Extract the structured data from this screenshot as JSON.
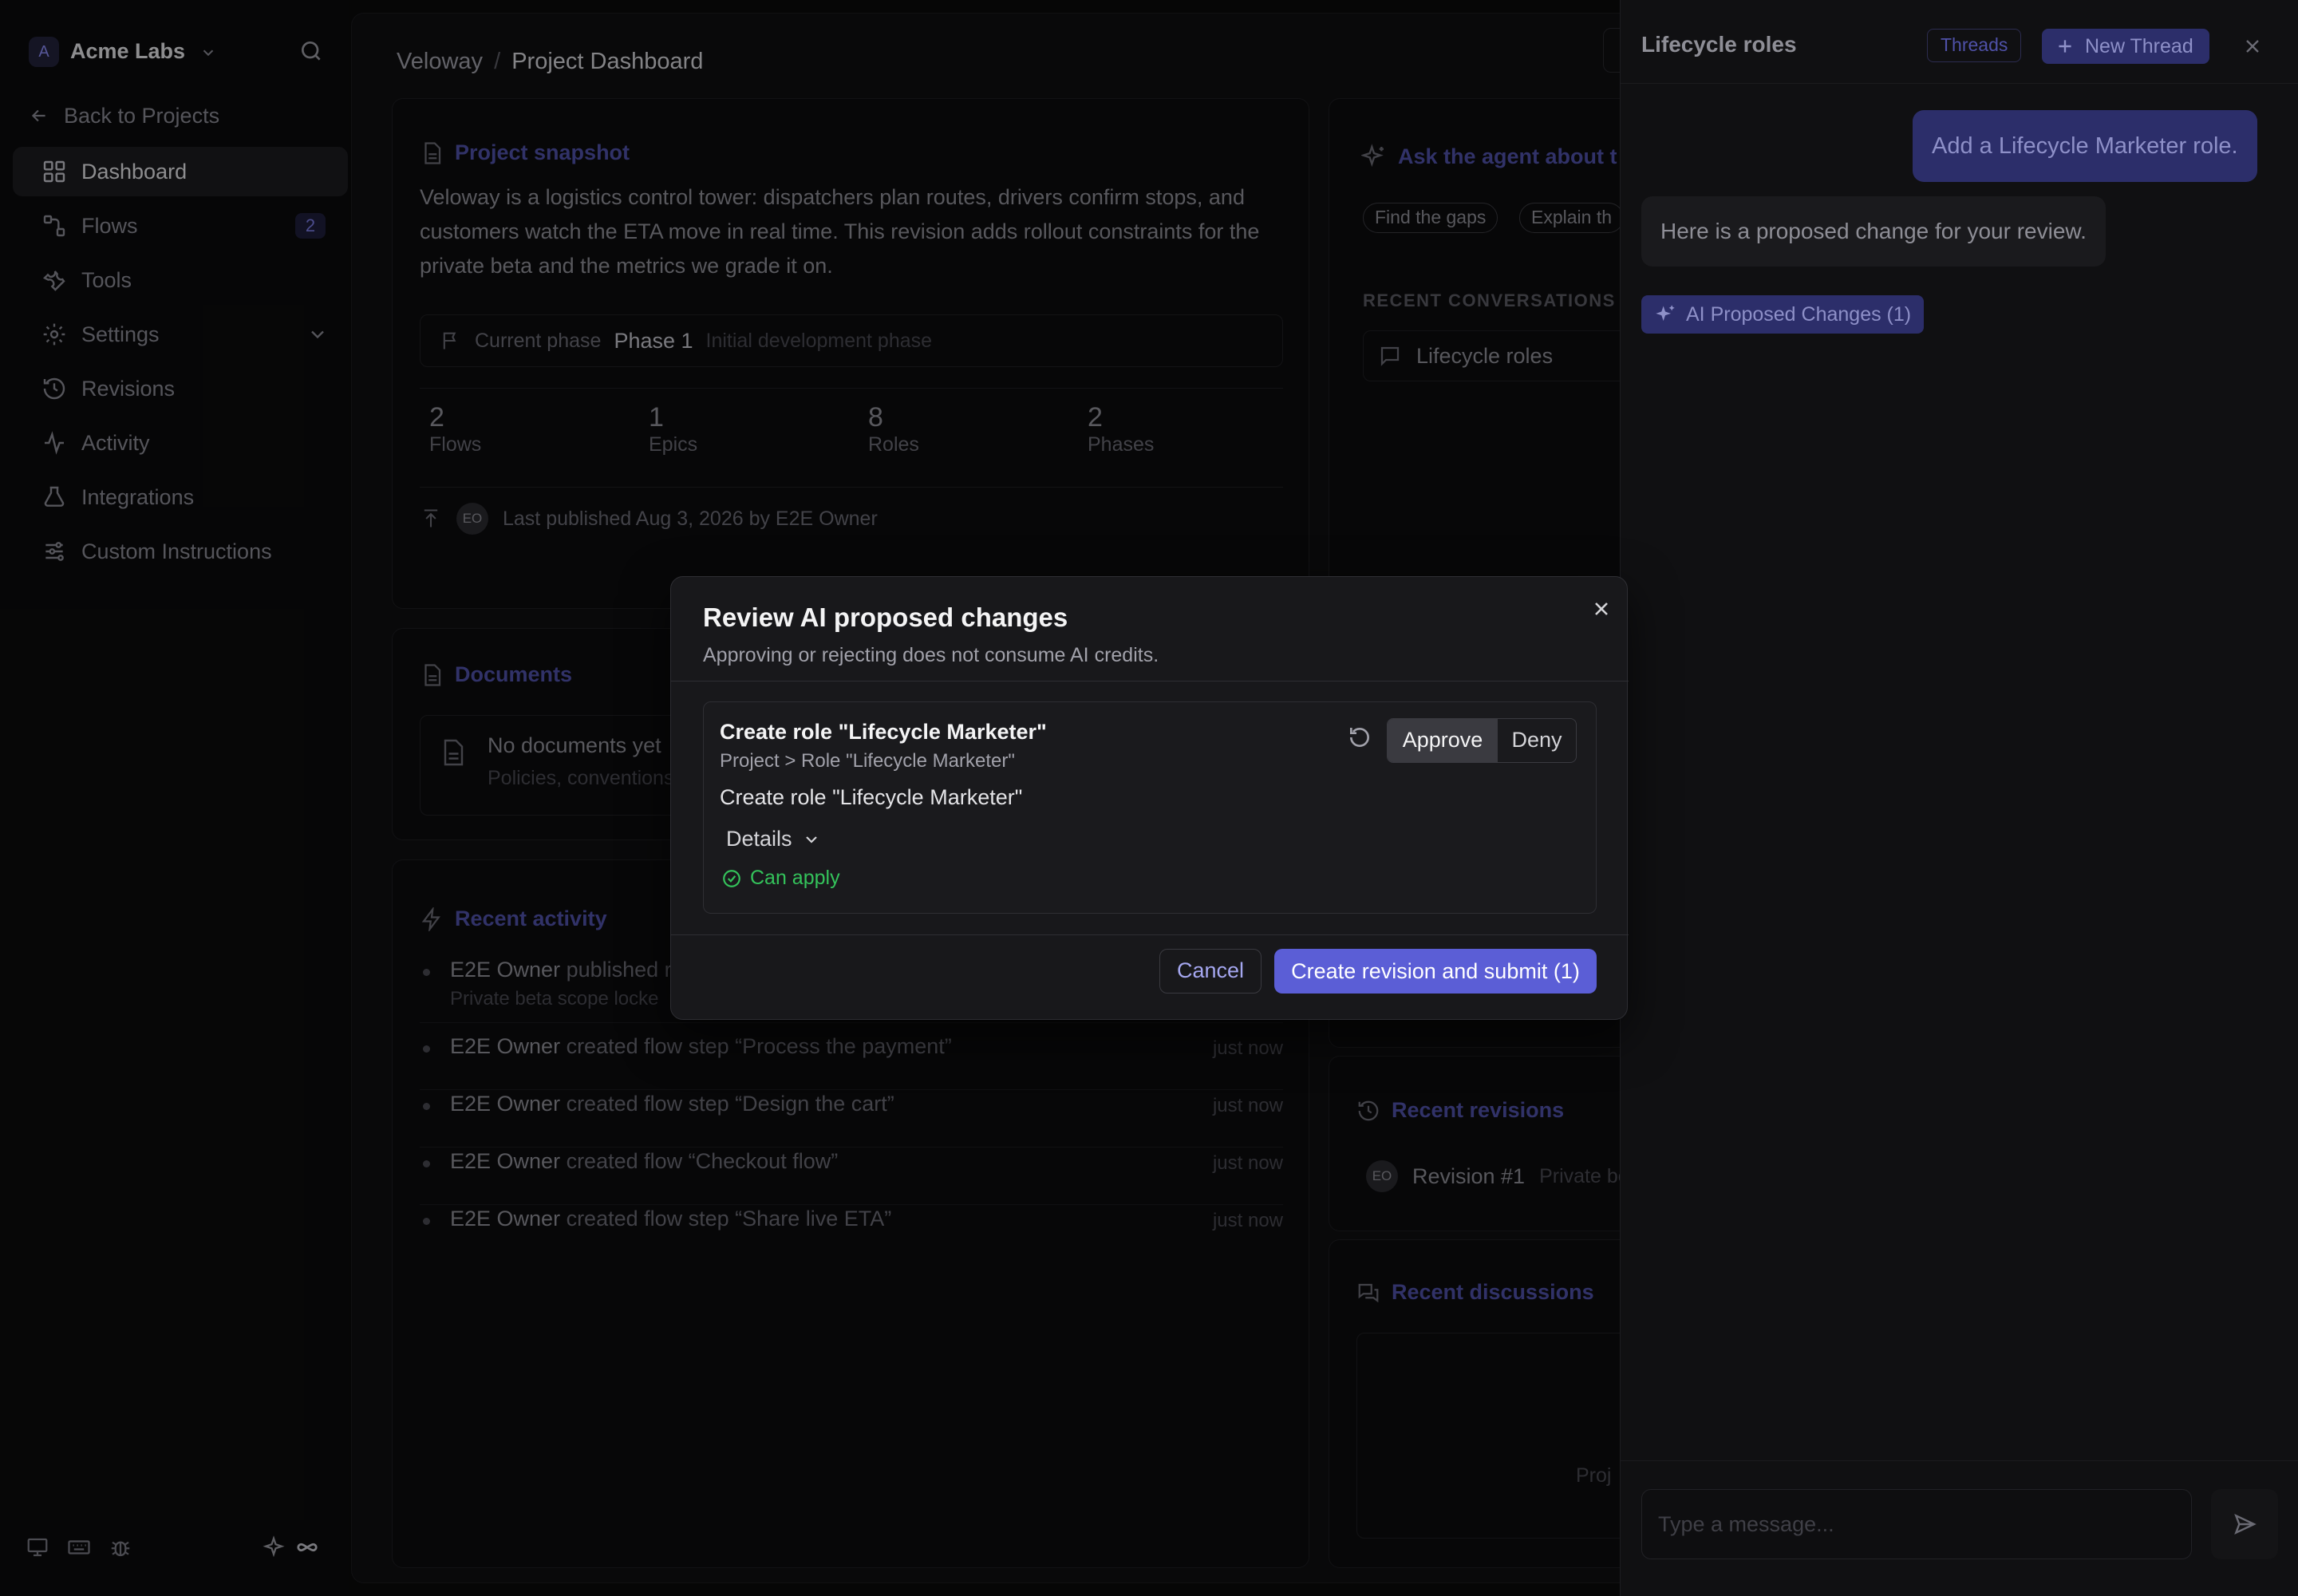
{
  "workspace": {
    "initial": "A",
    "name": "Acme Labs"
  },
  "sidebar": {
    "back_label": "Back to Projects",
    "items": [
      {
        "label": "Dashboard",
        "icon": "dashboard-icon",
        "active": true
      },
      {
        "label": "Flows",
        "icon": "flows-icon",
        "count": "2"
      },
      {
        "label": "Tools",
        "icon": "wrench-icon"
      },
      {
        "label": "Settings",
        "icon": "gear-icon",
        "expandable": true
      },
      {
        "label": "Revisions",
        "icon": "history-icon"
      },
      {
        "label": "Activity",
        "icon": "activity-icon"
      },
      {
        "label": "Integrations",
        "icon": "integrations-icon"
      },
      {
        "label": "Custom Instructions",
        "icon": "sliders-icon"
      }
    ],
    "footer_icons": [
      "monitor-icon",
      "keyboard-icon",
      "bug-icon",
      "sparkles-icon",
      "infinity-icon"
    ]
  },
  "breadcrumb": {
    "project": "Veloway",
    "separator": "/",
    "page": "Project Dashboard"
  },
  "snapshot": {
    "title": "Project snapshot",
    "description": "Veloway is a logistics control tower: dispatchers plan routes, drivers confirm stops, and customers watch the ETA move in real time. This revision adds rollout constraints for the private beta and the metrics we grade it on.",
    "phase_label": "Current phase",
    "phase_value": "Phase 1",
    "phase_desc": "Initial development phase",
    "stats": [
      {
        "value": "2",
        "label": "Flows"
      },
      {
        "value": "1",
        "label": "Epics"
      },
      {
        "value": "8",
        "label": "Roles"
      },
      {
        "value": "2",
        "label": "Phases"
      }
    ],
    "avatar": "EO",
    "published": "Last published Aug 3, 2026 by E2E Owner"
  },
  "documents": {
    "title": "Documents",
    "empty_title": "No documents yet",
    "empty_desc": "Policies, conventions"
  },
  "activity": {
    "title": "Recent activity",
    "items": [
      {
        "actor": "E2E Owner",
        "text": " published r",
        "sub": "Private beta scope locke",
        "time": ""
      },
      {
        "actor": "E2E Owner",
        "text": " created flow step “Process the payment”",
        "time": "just now"
      },
      {
        "actor": "E2E Owner",
        "text": " created flow step “Design the cart”",
        "time": "just now"
      },
      {
        "actor": "E2E Owner",
        "text": " created flow “Checkout flow”",
        "time": "just now"
      },
      {
        "actor": "E2E Owner",
        "text": " created flow step “Share live ETA”",
        "time": "just now"
      }
    ]
  },
  "agent": {
    "title": "Ask the agent about t",
    "chips": [
      "Find the gaps",
      "Explain th"
    ],
    "recent_label": "RECENT CONVERSATIONS",
    "conversation": "Lifecycle roles"
  },
  "revisions": {
    "title": "Recent revisions",
    "avatar": "EO",
    "item": "Revision #1",
    "item_desc": "Private be"
  },
  "discussions": {
    "title": "Recent discussions",
    "partial": "Proj"
  },
  "chat": {
    "title": "Lifecycle roles",
    "threads_label": "Threads",
    "new_thread_label": "New Thread",
    "user_message": "Add a Lifecycle Marketer role.",
    "assistant_message": "Here is a proposed change for your review.",
    "changes_chip": "AI Proposed Changes (1)",
    "input_placeholder": "Type a message..."
  },
  "modal": {
    "title": "Review AI proposed changes",
    "subtitle": "Approving or rejecting does not consume AI credits.",
    "change_title": "Create role \"Lifecycle Marketer\"",
    "change_path": "Project > Role \"Lifecycle Marketer\"",
    "change_desc": "Create role \"Lifecycle Marketer\"",
    "approve_label": "Approve",
    "deny_label": "Deny",
    "details_label": "Details",
    "status_label": "Can apply",
    "cancel_label": "Cancel",
    "submit_label": "Create revision and submit (1)"
  },
  "colors": {
    "accent": "#5b5ed6",
    "success": "#34c35b",
    "link": "#4f51a8"
  }
}
